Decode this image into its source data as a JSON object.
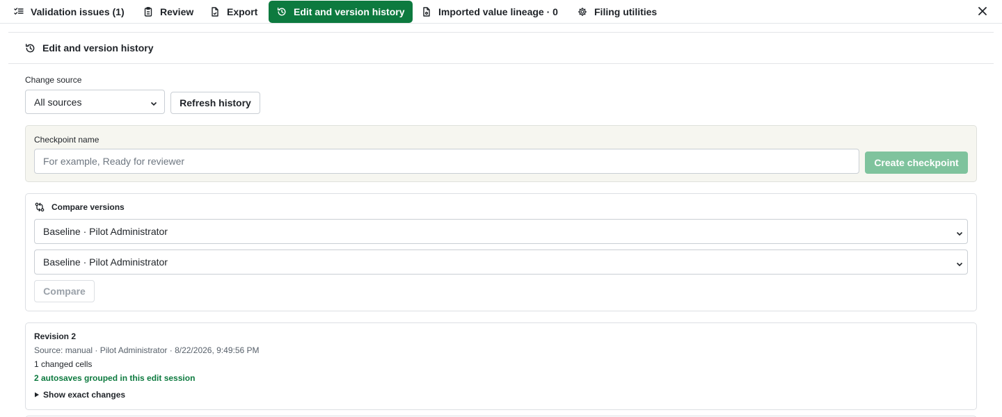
{
  "tabs": [
    {
      "label": "Validation issues (1)",
      "icon": "checklist-icon",
      "active": false
    },
    {
      "label": "Review",
      "icon": "clipboard-icon",
      "active": false
    },
    {
      "label": "Export",
      "icon": "file-export-icon",
      "active": false
    },
    {
      "label": "Edit and version history",
      "icon": "history-icon",
      "active": true
    },
    {
      "label": "Imported value lineage · 0",
      "icon": "file-lineage-icon",
      "active": false
    },
    {
      "label": "Filing utilities",
      "icon": "gear-icon",
      "active": false
    }
  ],
  "section": {
    "title": "Edit and version history",
    "icon": "history-icon"
  },
  "change_source": {
    "label": "Change source",
    "selected": "All sources",
    "refresh_label": "Refresh history"
  },
  "checkpoint": {
    "label": "Checkpoint name",
    "placeholder": "For example, Ready for reviewer",
    "value": "",
    "button_label": "Create checkpoint"
  },
  "compare": {
    "title": "Compare versions",
    "icon": "compare-icon",
    "version_a": "Baseline · Pilot Administrator",
    "version_b": "Baseline · Pilot Administrator",
    "button_label": "Compare"
  },
  "revision": {
    "title": "Revision 2",
    "meta": "Source: manual · Pilot Administrator · 8/22/2026, 9:49:56 PM",
    "changed": "1 changed cells",
    "autosave_note": "2 autosaves grouped in this edit session",
    "toggle_label": "Show exact changes"
  },
  "colors": {
    "accent": "#0d7a3f",
    "accent_disabled": "#7fc39d",
    "panel_bg": "#f6f6f0",
    "border": "#c9ced4"
  }
}
